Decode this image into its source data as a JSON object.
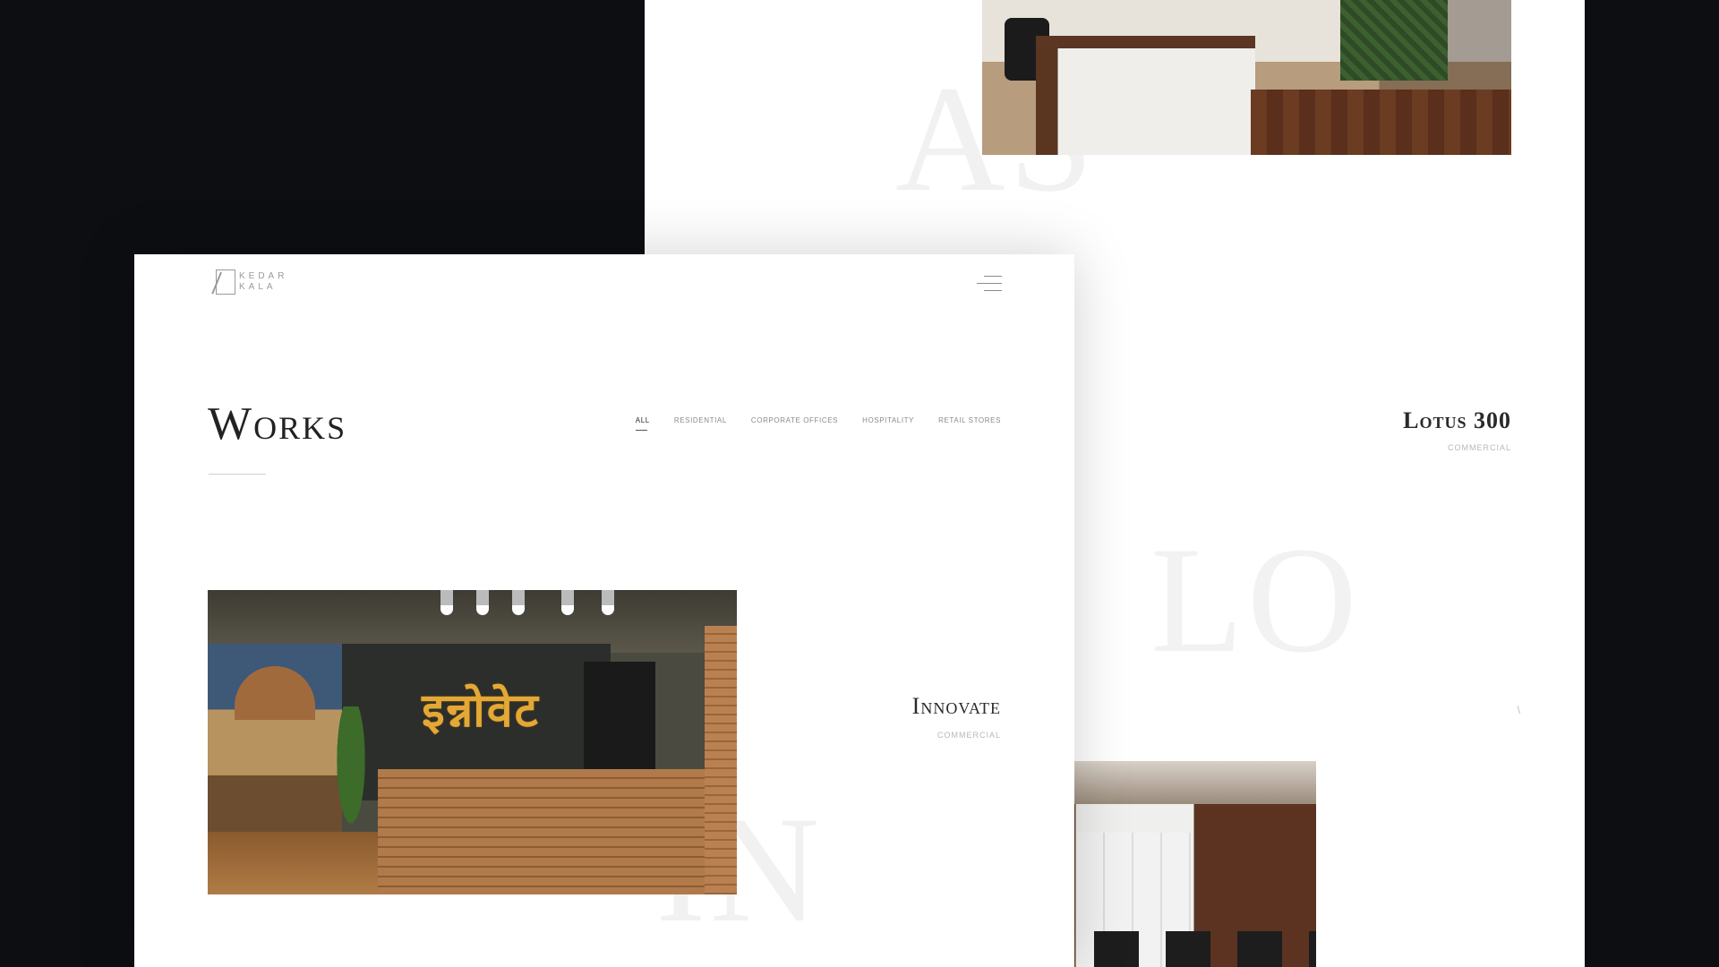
{
  "brand": {
    "name_line1": "KEDAR",
    "name_line2": "KALA"
  },
  "header": {
    "menu_icon": "hamburger-icon"
  },
  "works": {
    "title": "Works",
    "filters": [
      "All",
      "Residential",
      "Corporate Offices",
      "Hospitality",
      "Retail Stores"
    ],
    "active_filter": "All"
  },
  "projects": [
    {
      "title": "Innovate",
      "category": "Commercial",
      "ghost_letters": "IN",
      "photo_sign_text": "इन्नोवेट"
    },
    {
      "title": "Lotus 300",
      "category": "Commercial",
      "ghost_letters": "LO"
    }
  ],
  "back_page": {
    "ghost_letters": "AS",
    "stray_char": "\\"
  },
  "colors": {
    "backdrop": "#0c0e12",
    "page": "#ffffff",
    "heading": "#222222",
    "muted": "#b8b8b8",
    "sign": "#e4a836"
  }
}
